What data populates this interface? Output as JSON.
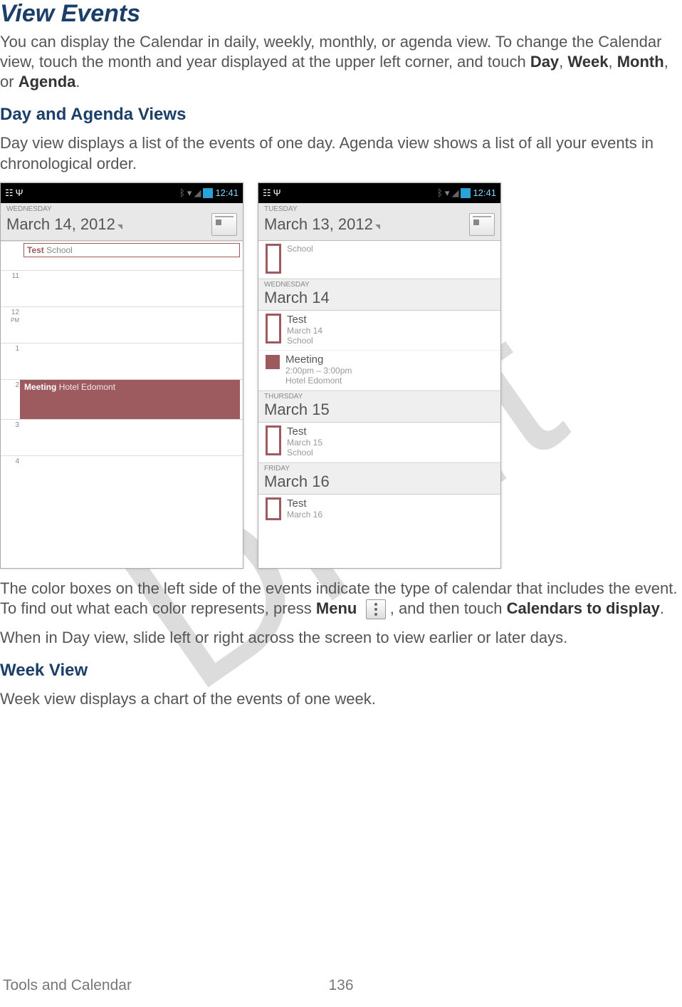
{
  "watermark": "Draft",
  "title": "View Events",
  "intro": {
    "p1a": "You can display the Calendar in daily, weekly, monthly, or agenda view. To change the Calendar view, touch the month and year displayed at the upper left corner, and touch ",
    "day": "Day",
    "comma1": ", ",
    "week": "Week",
    "comma2": ", ",
    "month": "Month",
    "or": ", or ",
    "agenda": "Agenda",
    "period": "."
  },
  "sections": {
    "dayAgenda": {
      "heading": "Day and Agenda Views",
      "desc": "Day view displays a list of the events of one day. Agenda view shows a list of all your events in chronological order."
    },
    "week": {
      "heading": "Week View",
      "desc": "Week view displays a chart of the events of one week."
    }
  },
  "dayView": {
    "time": "12:41",
    "dow": "WEDNESDAY",
    "date": "March 14, 2012",
    "pm": "PM",
    "hours": [
      "11",
      "12",
      "1",
      "2",
      "3",
      "4"
    ],
    "events": [
      {
        "title": "Test",
        "loc": "School"
      },
      {
        "title": "Meeting",
        "loc": "Hotel Edomont"
      }
    ]
  },
  "agendaView": {
    "time": "12:41",
    "dow": "TUESDAY",
    "date": "March 13, 2012",
    "days": [
      {
        "events": [
          {
            "sub": "School"
          }
        ]
      },
      {
        "dow": "WEDNESDAY",
        "date": "March 14",
        "events": [
          {
            "title": "Test",
            "sub1": "March 14",
            "sub2": "School"
          },
          {
            "title": "Meeting",
            "sub1": "2:00pm – 3:00pm",
            "sub2": "Hotel Edomont"
          }
        ]
      },
      {
        "dow": "THURSDAY",
        "date": "March 15",
        "events": [
          {
            "title": "Test",
            "sub1": "March 15",
            "sub2": "School"
          }
        ]
      },
      {
        "dow": "FRIDAY",
        "date": "March 16",
        "events": [
          {
            "title": "Test",
            "sub1": "March 16"
          }
        ]
      }
    ]
  },
  "afterShots": {
    "p1a": "The color boxes on the left side of the events indicate the type of calendar that includes the event. To find out what each color represents, press ",
    "menu": "Menu",
    "p1b": ", and then touch ",
    "calToDisplay": "Calendars to display",
    "period": ".",
    "p2": "When in Day view, slide left or right across the screen to view earlier or later days."
  },
  "footer": {
    "section": "Tools and Calendar",
    "page": "136"
  }
}
